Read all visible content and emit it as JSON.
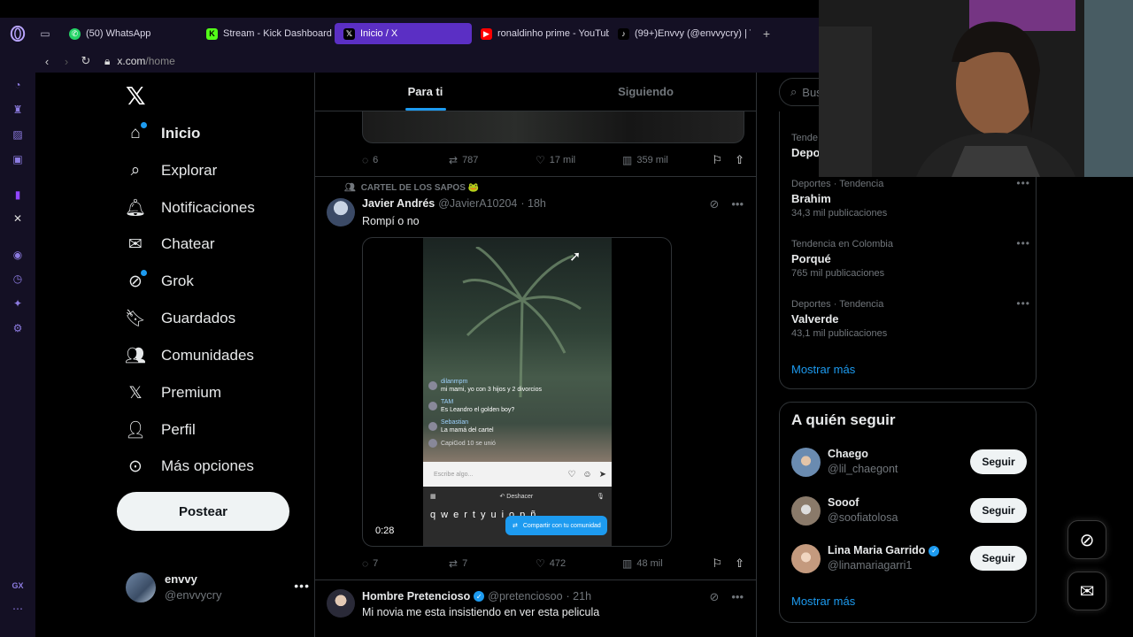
{
  "browser": {
    "tabs": [
      {
        "label": "(50) WhatsApp",
        "icon": "whatsapp-icon",
        "color": "#25d366"
      },
      {
        "label": "Stream - Kick Dashboard",
        "icon": "kick-icon",
        "color": "#53fc18"
      },
      {
        "label": "Inicio / X",
        "icon": "x-icon",
        "color": "#000000"
      },
      {
        "label": "ronaldinho prime - YouTub",
        "icon": "youtube-icon",
        "color": "#ff0000"
      },
      {
        "label": "(99+)Envvy (@envvycry) | T",
        "icon": "tiktok-icon",
        "color": "#000000"
      }
    ],
    "active_tab": 2,
    "url_domain": "x.com",
    "url_path": "/home",
    "accent": "#5b2fc4"
  },
  "nav": {
    "items": [
      {
        "label": "Inicio",
        "icon": "home-icon"
      },
      {
        "label": "Explorar",
        "icon": "search-icon"
      },
      {
        "label": "Notificaciones",
        "icon": "bell-icon"
      },
      {
        "label": "Chatear",
        "icon": "mail-icon"
      },
      {
        "label": "Grok",
        "icon": "grok-icon"
      },
      {
        "label": "Guardados",
        "icon": "bookmark-icon"
      },
      {
        "label": "Comunidades",
        "icon": "communities-icon"
      },
      {
        "label": "Premium",
        "icon": "x-icon"
      },
      {
        "label": "Perfil",
        "icon": "person-icon"
      },
      {
        "label": "Más opciones",
        "icon": "more-circle-icon"
      }
    ],
    "post_label": "Postear",
    "user": {
      "name": "envvy",
      "handle": "@envvycry"
    }
  },
  "feed": {
    "tabs": [
      {
        "label": "Para ti"
      },
      {
        "label": "Siguiendo"
      }
    ],
    "active_tab": 0,
    "prev_tweet": {
      "replies": "6",
      "reposts": "787",
      "likes": "17 mil",
      "views": "359 mil"
    },
    "tweet1": {
      "community": "CARTEL DE LOS SAPOS 🐸",
      "name": "Javier Andrés",
      "handle": "@JavierA10204",
      "time": "· 18h",
      "text": "Rompí o no",
      "duration": "0:28",
      "video_chat": [
        {
          "user": "dilanmpm",
          "msg": "mi mami, yo con 3 hijos y 2 divorcios"
        },
        {
          "user": "TAM",
          "msg": "Es Leandro el golden boy?"
        },
        {
          "user": "Sebastian",
          "msg": "La mamá del cartel"
        },
        {
          "user": "CapiGod 10",
          "msg": "se unió"
        }
      ],
      "video_input_placeholder": "Escribe algo...",
      "video_undo": "Deshacer",
      "video_share": "Compartir con tu comunidad",
      "video_keys": [
        "q",
        "w",
        "e",
        "r",
        "t",
        "y",
        "u",
        "i",
        "o",
        "p",
        "ñ"
      ],
      "replies": "7",
      "reposts": "7",
      "likes": "472",
      "views": "48 mil"
    },
    "tweet2": {
      "name": "Hombre Pretencioso",
      "handle": "@pretenciosoo",
      "time": "· 21h",
      "text": "Mi novia me esta insistiendo en ver esta pelicula"
    }
  },
  "sidebar": {
    "search_placeholder": "Bus",
    "trends": [
      {
        "meta": "Tende",
        "title": "Depo",
        "count": ""
      },
      {
        "meta": "Deportes · Tendencia",
        "title": "Brahim",
        "count": "34,3 mil publicaciones"
      },
      {
        "meta": "Tendencia en Colombia",
        "title": "Porqué",
        "count": "765 mil publicaciones"
      },
      {
        "meta": "Deportes · Tendencia",
        "title": "Valverde",
        "count": "43,1 mil publicaciones"
      }
    ],
    "trends_more": "Mostrar más",
    "follow_title": "A quién seguir",
    "follow": [
      {
        "name": "Chaego",
        "handle": "@lil_chaegont",
        "verified": false
      },
      {
        "name": "Sooof",
        "handle": "@soofiatolosa",
        "verified": false
      },
      {
        "name": "Lina Maria Garrido",
        "handle": "@linamariagarri1",
        "verified": true
      }
    ],
    "follow_button": "Seguir",
    "follow_more": "Mostrar más"
  },
  "colors": {
    "x_blue": "#1d9bf0",
    "border": "#2f3336",
    "muted": "#71767b"
  }
}
